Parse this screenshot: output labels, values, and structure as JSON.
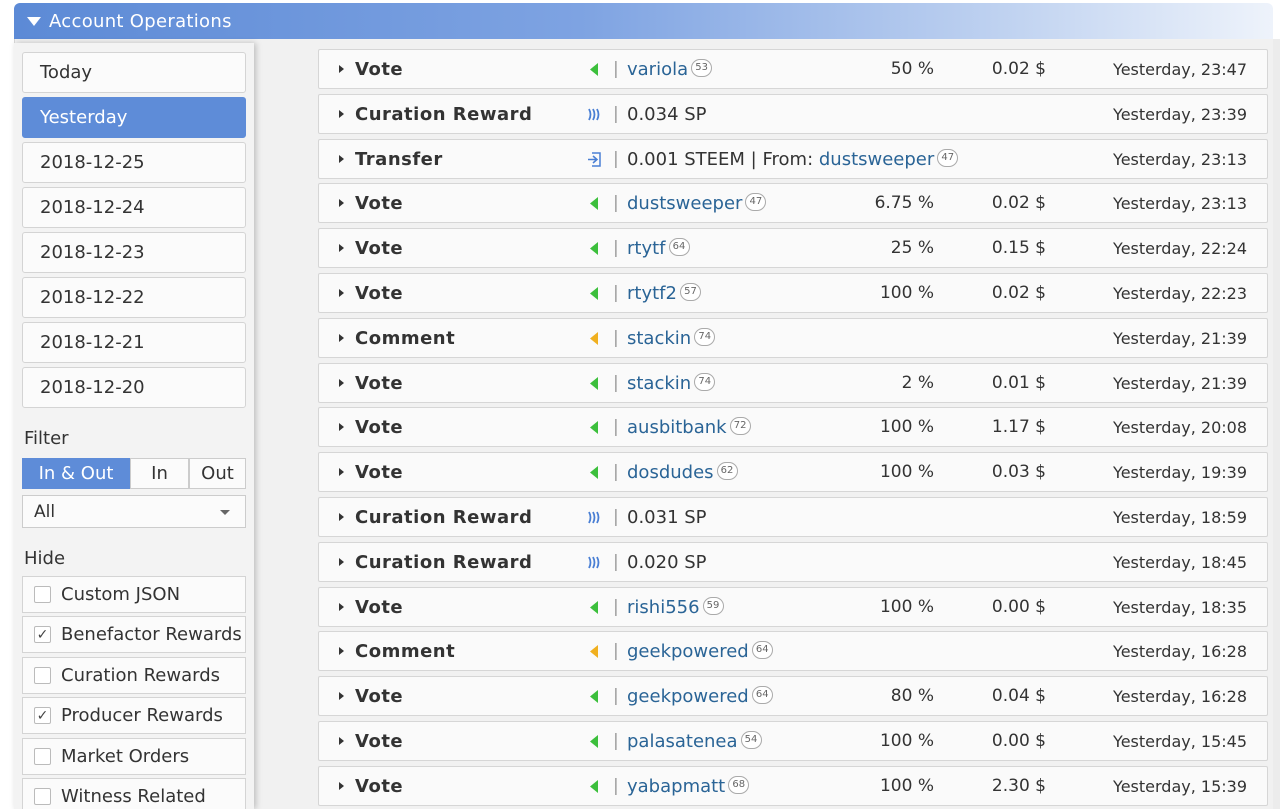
{
  "header": {
    "title": "Account Operations"
  },
  "dates": [
    "Today",
    "Yesterday",
    "2018-12-25",
    "2018-12-24",
    "2018-12-23",
    "2018-12-22",
    "2018-12-21",
    "2018-12-20"
  ],
  "active_date": "Yesterday",
  "filter": {
    "label": "Filter",
    "segments": [
      "In & Out",
      "In",
      "Out"
    ],
    "active_segment": "In & Out",
    "select_value": "All"
  },
  "hide": {
    "label": "Hide",
    "items": [
      {
        "label": "Custom JSON",
        "checked": false
      },
      {
        "label": "Benefactor Rewards",
        "checked": true
      },
      {
        "label": "Curation Rewards",
        "checked": false
      },
      {
        "label": "Producer Rewards",
        "checked": true
      },
      {
        "label": "Market Orders",
        "checked": false
      },
      {
        "label": "Witness Related",
        "checked": false
      }
    ]
  },
  "colors": {
    "accent": "#5e8cd8",
    "vote_green": "#3cbf3c",
    "comment_orange": "#f0b020",
    "steem_blue": "#4a7fd4",
    "link": "#2a6496"
  },
  "operations": [
    {
      "type": "Vote",
      "icon": "vote-icon",
      "user": "variola",
      "rep": "53",
      "pct": "50 %",
      "usd": "0.02 $",
      "time": "Yesterday, 23:47"
    },
    {
      "type": "Curation Reward",
      "icon": "steem-icon",
      "amount": "0.034 SP",
      "time": "Yesterday, 23:39"
    },
    {
      "type": "Transfer",
      "icon": "transfer-in-icon",
      "amount": "0.001 STEEM",
      "from_label": "From:",
      "user": "dustsweeper",
      "rep": "47",
      "time": "Yesterday, 23:13"
    },
    {
      "type": "Vote",
      "icon": "vote-icon",
      "user": "dustsweeper",
      "rep": "47",
      "pct": "6.75 %",
      "usd": "0.02 $",
      "time": "Yesterday, 23:13"
    },
    {
      "type": "Vote",
      "icon": "vote-icon",
      "user": "rtytf",
      "rep": "64",
      "pct": "25 %",
      "usd": "0.15 $",
      "time": "Yesterday, 22:24"
    },
    {
      "type": "Vote",
      "icon": "vote-icon",
      "user": "rtytf2",
      "rep": "57",
      "pct": "100 %",
      "usd": "0.02 $",
      "time": "Yesterday, 22:23"
    },
    {
      "type": "Comment",
      "icon": "comment-icon",
      "user": "stackin",
      "rep": "74",
      "time": "Yesterday, 21:39"
    },
    {
      "type": "Vote",
      "icon": "vote-icon",
      "user": "stackin",
      "rep": "74",
      "pct": "2 %",
      "usd": "0.01 $",
      "time": "Yesterday, 21:39"
    },
    {
      "type": "Vote",
      "icon": "vote-icon",
      "user": "ausbitbank",
      "rep": "72",
      "pct": "100 %",
      "usd": "1.17 $",
      "time": "Yesterday, 20:08"
    },
    {
      "type": "Vote",
      "icon": "vote-icon",
      "user": "dosdudes",
      "rep": "62",
      "pct": "100 %",
      "usd": "0.03 $",
      "time": "Yesterday, 19:39"
    },
    {
      "type": "Curation Reward",
      "icon": "steem-icon",
      "amount": "0.031 SP",
      "time": "Yesterday, 18:59"
    },
    {
      "type": "Curation Reward",
      "icon": "steem-icon",
      "amount": "0.020 SP",
      "time": "Yesterday, 18:45"
    },
    {
      "type": "Vote",
      "icon": "vote-icon",
      "user": "rishi556",
      "rep": "59",
      "pct": "100 %",
      "usd": "0.00 $",
      "time": "Yesterday, 18:35"
    },
    {
      "type": "Comment",
      "icon": "comment-icon",
      "user": "geekpowered",
      "rep": "64",
      "time": "Yesterday, 16:28"
    },
    {
      "type": "Vote",
      "icon": "vote-icon",
      "user": "geekpowered",
      "rep": "64",
      "pct": "80 %",
      "usd": "0.04 $",
      "time": "Yesterday, 16:28"
    },
    {
      "type": "Vote",
      "icon": "vote-icon",
      "user": "palasatenea",
      "rep": "54",
      "pct": "100 %",
      "usd": "0.00 $",
      "time": "Yesterday, 15:45"
    },
    {
      "type": "Vote",
      "icon": "vote-icon",
      "user": "yabapmatt",
      "rep": "68",
      "pct": "100 %",
      "usd": "2.30 $",
      "time": "Yesterday, 15:39"
    }
  ]
}
